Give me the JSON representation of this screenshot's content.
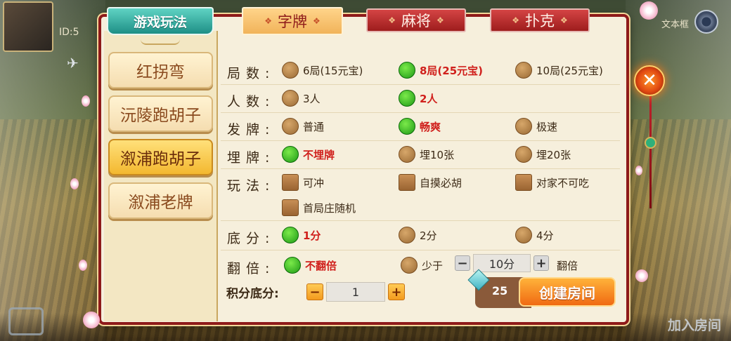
{
  "header": {
    "uid_text": "ID:5",
    "right_label": "文本框",
    "rules_tab": "游戏玩法",
    "category_tabs": [
      {
        "label": "字牌",
        "selected": true
      },
      {
        "label": "麻将",
        "selected": false
      },
      {
        "label": "扑克",
        "selected": false
      }
    ]
  },
  "modes": [
    {
      "label": "红拐弯",
      "selected": false
    },
    {
      "label": "沅陵跑胡子",
      "selected": false
    },
    {
      "label": "溆浦跑胡子",
      "selected": true
    },
    {
      "label": "溆浦老牌",
      "selected": false
    }
  ],
  "options": {
    "rounds": {
      "label": "局数:",
      "choices": [
        "6局(15元宝)",
        "8局(25元宝)",
        "10局(25元宝)"
      ],
      "selected": 1
    },
    "players": {
      "label": "人数:",
      "choices": [
        "3人",
        "2人"
      ],
      "selected": 1
    },
    "deal": {
      "label": "发牌:",
      "choices": [
        "普通",
        "畅爽",
        "极速"
      ],
      "selected": 1
    },
    "bury": {
      "label": "埋牌:",
      "choices": [
        "不埋牌",
        "埋10张",
        "埋20张"
      ],
      "selected": 0
    },
    "play": {
      "label": "玩法:",
      "checkboxes": [
        "可冲",
        "自摸必胡",
        "对家不可吃",
        "首局庄随机"
      ]
    },
    "base": {
      "label": "底分:",
      "choices": [
        "1分",
        "2分",
        "4分"
      ],
      "selected": 0
    },
    "double": {
      "label": "翻倍:",
      "choices": [
        "不翻倍",
        "少于"
      ],
      "selected": 0,
      "threshold_value": "10分",
      "suffix": "翻倍"
    }
  },
  "score_base": {
    "label": "积分底分:",
    "value": "1"
  },
  "footer": {
    "cost": "25",
    "create_label": "创建房间",
    "join_label": "加入房间"
  },
  "colors": {
    "selected_text": "#d0201c",
    "panel_border": "#8e1a1a",
    "accent_orange": "#f06a12",
    "tab_teal": "#1e8f86"
  }
}
